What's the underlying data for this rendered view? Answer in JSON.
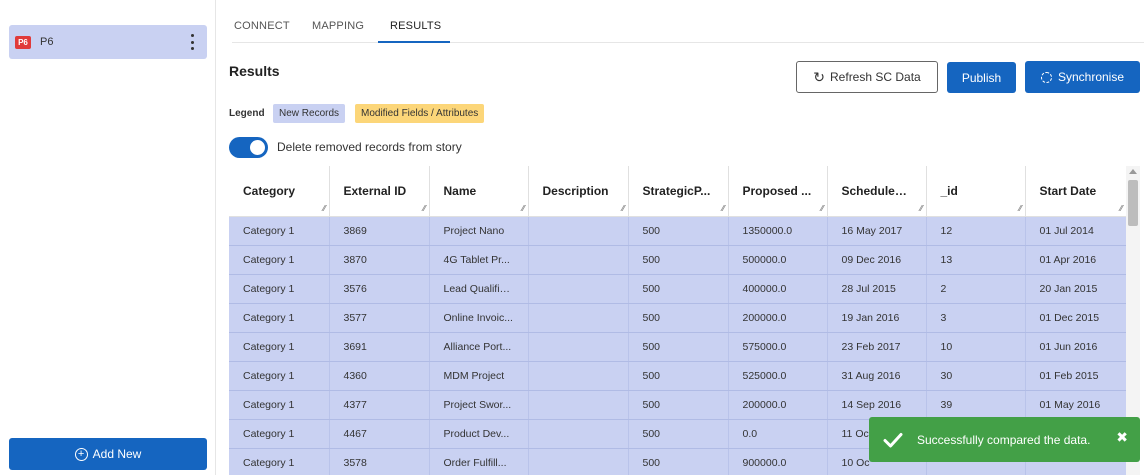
{
  "sidebar": {
    "project": {
      "badge": "P6",
      "name": "P6"
    },
    "add_new_label": "Add New"
  },
  "tabs": [
    {
      "label": "CONNECT",
      "active": false
    },
    {
      "label": "MAPPING",
      "active": false
    },
    {
      "label": "RESULTS",
      "active": true
    }
  ],
  "results": {
    "title": "Results",
    "buttons": {
      "refresh": "Refresh SC Data",
      "publish": "Publish",
      "synchronise": "Synchronise"
    },
    "legend": {
      "label": "Legend",
      "new_records": "New Records",
      "modified": "Modified Fields / Attributes"
    },
    "toggle": {
      "label": "Delete removed records from story",
      "on": true
    }
  },
  "table": {
    "columns": [
      "Category",
      "External ID",
      "Name",
      "Description",
      "StrategicP...",
      "Proposed ...",
      "Scheduled...",
      "_id",
      "Start Date"
    ],
    "rows": [
      [
        "Category 1",
        "3869",
        "Project Nano",
        "",
        "500",
        "1350000.0",
        "16 May 2017",
        "12",
        "01 Jul 2014"
      ],
      [
        "Category 1",
        "3870",
        "4G Tablet Pr...",
        "",
        "500",
        "500000.0",
        "09 Dec 2016",
        "13",
        "01 Apr 2016"
      ],
      [
        "Category 1",
        "3576",
        "Lead Qualific...",
        "",
        "500",
        "400000.0",
        "28 Jul 2015",
        "2",
        "20 Jan 2015"
      ],
      [
        "Category 1",
        "3577",
        "Online Invoic...",
        "",
        "500",
        "200000.0",
        "19 Jan 2016",
        "3",
        "01 Dec 2015"
      ],
      [
        "Category 1",
        "3691",
        "Alliance Port...",
        "",
        "500",
        "575000.0",
        "23 Feb 2017",
        "10",
        "01 Jun 2016"
      ],
      [
        "Category 1",
        "4360",
        "MDM Project",
        "",
        "500",
        "525000.0",
        "31 Aug 2016",
        "30",
        "01 Feb 2015"
      ],
      [
        "Category 1",
        "4377",
        "Project Swor...",
        "",
        "500",
        "200000.0",
        "14 Sep 2016",
        "39",
        "01 May 2016"
      ],
      [
        "Category 1",
        "4467",
        "Product Dev...",
        "",
        "500",
        "0.0",
        "11 Oc",
        "",
        ""
      ],
      [
        "Category 1",
        "3578",
        "Order Fulfill...",
        "",
        "500",
        "900000.0",
        "10 Oc",
        "",
        ""
      ]
    ]
  },
  "toast": {
    "message": "Successfully compared the data.",
    "close": "✖"
  },
  "colors": {
    "primary": "#1565c0",
    "new_record": "#c9d1f2",
    "modified": "#fcd679",
    "success": "#43a047"
  }
}
